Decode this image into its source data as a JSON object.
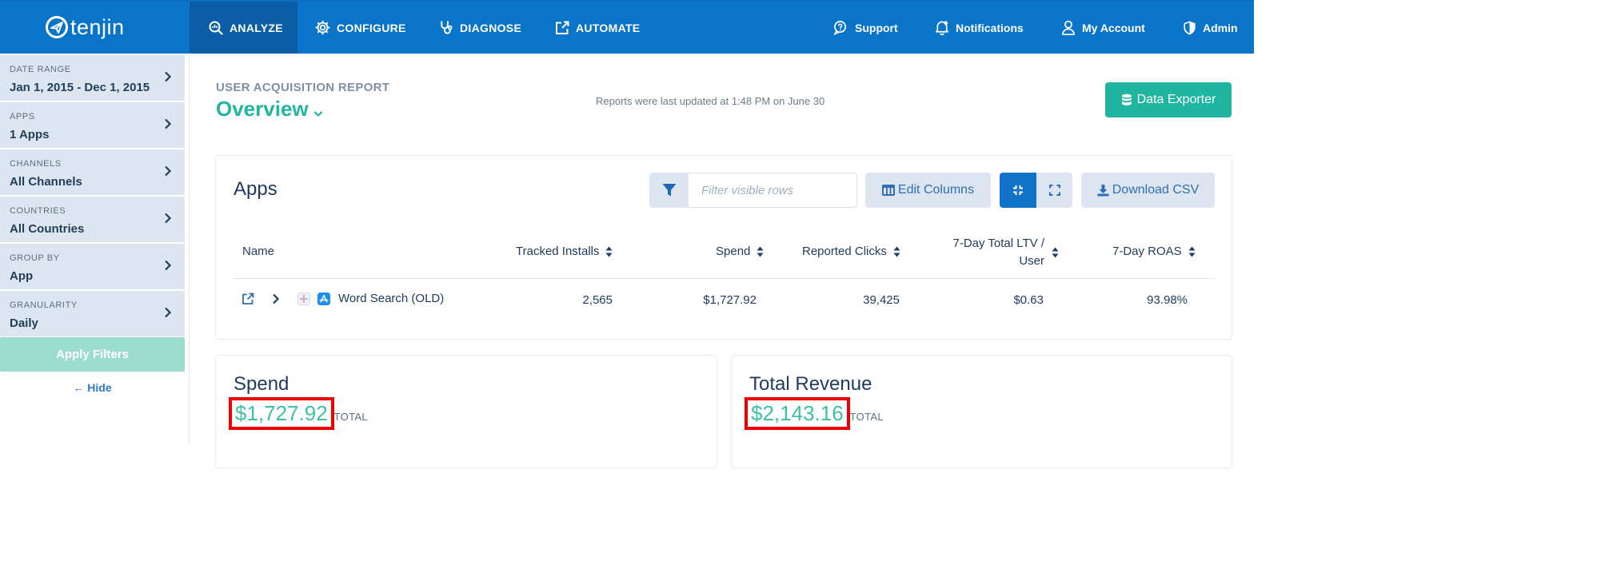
{
  "brand": {
    "name": "tenjin"
  },
  "nav": {
    "items": [
      {
        "label": "ANALYZE",
        "icon": "analyze-icon",
        "active": true
      },
      {
        "label": "CONFIGURE",
        "icon": "gear-icon",
        "active": false
      },
      {
        "label": "DIAGNOSE",
        "icon": "stethoscope-icon",
        "active": false
      },
      {
        "label": "AUTOMATE",
        "icon": "external-edit-icon",
        "active": false
      }
    ],
    "right": [
      {
        "label": "Support",
        "icon": "support-icon"
      },
      {
        "label": "Notifications",
        "icon": "bell-icon"
      },
      {
        "label": "My Account",
        "icon": "user-icon"
      },
      {
        "label": "Admin",
        "icon": "shield-icon"
      }
    ]
  },
  "sidebar": {
    "filters": [
      {
        "label": "DATE RANGE",
        "value": "Jan 1, 2015 - Dec 1, 2015"
      },
      {
        "label": "APPS",
        "value": "1 Apps"
      },
      {
        "label": "CHANNELS",
        "value": "All Channels"
      },
      {
        "label": "COUNTRIES",
        "value": "All Countries"
      },
      {
        "label": "GROUP BY",
        "value": "App"
      },
      {
        "label": "GRANULARITY",
        "value": "Daily"
      }
    ],
    "apply_label": "Apply Filters",
    "hide_label": "Hide"
  },
  "header": {
    "subtitle": "USER ACQUISITION REPORT",
    "title": "Overview",
    "updated": "Reports were last updated at 1:48 PM on June 30",
    "exporter_label": "Data Exporter"
  },
  "apps_table": {
    "title": "Apps",
    "filter_placeholder": "Filter visible rows",
    "edit_columns_label": "Edit Columns",
    "download_label": "Download CSV",
    "columns": [
      "Name",
      "Tracked Installs",
      "Spend",
      "Reported Clicks",
      "7-Day Total LTV / User",
      "7-Day ROAS"
    ],
    "rows": [
      {
        "name": "Word Search (OLD)",
        "tracked_installs": "2,565",
        "spend": "$1,727.92",
        "reported_clicks": "39,425",
        "ltv": "$0.63",
        "roas": "93.98%"
      }
    ]
  },
  "metrics": [
    {
      "title": "Spend",
      "value": "$1,727.92",
      "suffix": "TOTAL"
    },
    {
      "title": "Total Revenue",
      "value": "$2,143.16",
      "suffix": "TOTAL"
    }
  ],
  "colors": {
    "nav_bg": "#0a74c9",
    "nav_active": "#0b5ea6",
    "accent": "#1fb5a0",
    "highlight_box": "#ee0000"
  }
}
